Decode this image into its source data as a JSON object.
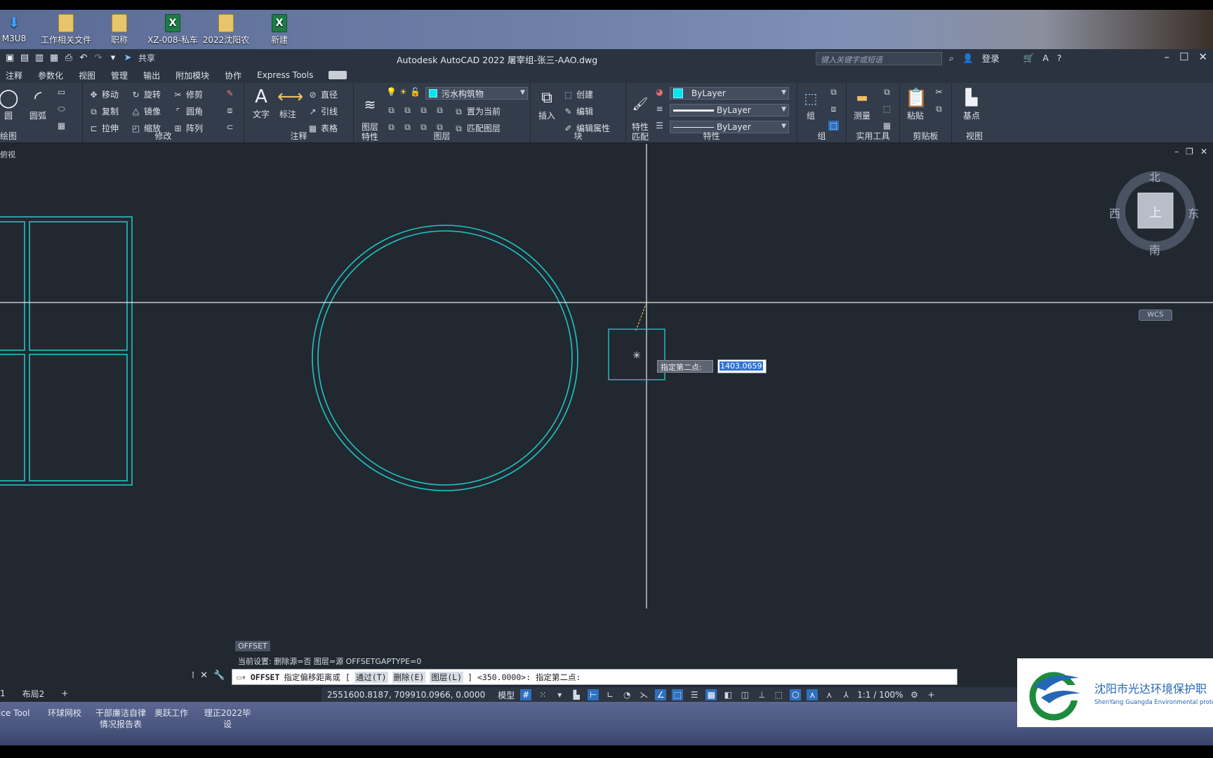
{
  "desktop": {
    "icons": [
      {
        "label": "M3U8",
        "kind": "arrow"
      },
      {
        "label": "工作相关文件",
        "kind": "folder"
      },
      {
        "label": "职称",
        "kind": "folder"
      },
      {
        "label": "XZ-008-私车",
        "kind": "excel"
      },
      {
        "label": "2022沈阳农",
        "kind": "folder"
      },
      {
        "label": "新建",
        "kind": "excel"
      }
    ],
    "bottom_icons": [
      {
        "label": "ice Tool"
      },
      {
        "label": "环球网校"
      },
      {
        "label": "干部廉洁自律\n情况报告表"
      },
      {
        "label": "奥跃工作"
      },
      {
        "label": "理正2022毕\n设"
      }
    ]
  },
  "app": {
    "title": "Autodesk AutoCAD 2022    屠宰组-张三-AAO.dwg",
    "share": "共享",
    "search_placeholder": "键入关键字或短语",
    "login": "登录"
  },
  "menu": [
    "注释",
    "参数化",
    "视图",
    "管理",
    "输出",
    "附加模块",
    "协作",
    "Express Tools"
  ],
  "ribbon": {
    "draw": {
      "title": "绘图",
      "circle": "圆",
      "arc": "圆弧"
    },
    "modify": {
      "title": "修改",
      "move": "移动",
      "rotate": "旋转",
      "trim": "修剪",
      "copy": "复制",
      "mirror": "镜像",
      "fillet": "圆角",
      "stretch": "拉伸",
      "scale": "缩放",
      "array": "阵列"
    },
    "annotation": {
      "title": "注释",
      "text": "文字",
      "dimension": "标注",
      "linear": "直径",
      "leader": "引线",
      "table": "表格"
    },
    "layers": {
      "title": "图层",
      "layer_props": "图层\n特性",
      "current_layer": "污水构筑物",
      "set_current": "置为当前",
      "match_layer": "匹配图层"
    },
    "block": {
      "title": "块",
      "insert": "插入",
      "create": "创建",
      "edit": "编辑",
      "edit_attr": "编辑属性"
    },
    "properties": {
      "title": "特性",
      "match": "特性\n匹配",
      "color": "ByLayer",
      "lineweight": "ByLayer",
      "linetype": "ByLayer"
    },
    "groups": {
      "title": "组",
      "group": "组"
    },
    "utilities": {
      "title": "实用工具",
      "measure": "测量"
    },
    "clipboard": {
      "title": "剪贴板",
      "paste": "粘贴"
    },
    "view": {
      "title": "视图",
      "base": "基点"
    }
  },
  "viewcube": {
    "north": "北",
    "south": "南",
    "east": "东",
    "west": "西",
    "top": "上",
    "wcs": "WCS"
  },
  "dynamic_input": {
    "prompt": "指定第二点:",
    "value": "1403.0659"
  },
  "command": {
    "history_1": "OFFSET",
    "history_2": "当前设置: 删除源=否  图层=源  OFFSETGAPTYPE=0",
    "cmd": "OFFSET",
    "prompt": "指定偏移距离或 [",
    "opt_through": "通过(T)",
    "opt_erase": "删除(E)",
    "opt_layer": "图层(L)",
    "tail": "] <350.0000>:  指定第二点:"
  },
  "layout_tabs": [
    "1",
    "布局2",
    "+"
  ],
  "status": {
    "coords": "2551600.8187, 709910.0966, 0.0000",
    "model": "模型",
    "scale": "1:1 / 100%"
  },
  "logo": {
    "cn": "沈阳市光达环境保护职",
    "en": "ShenYang Guangda Environmental protec"
  },
  "colors": {
    "drawing_bg": "#212830",
    "geometry": "#20c4c4",
    "crosshair": "#e6e9ee"
  }
}
